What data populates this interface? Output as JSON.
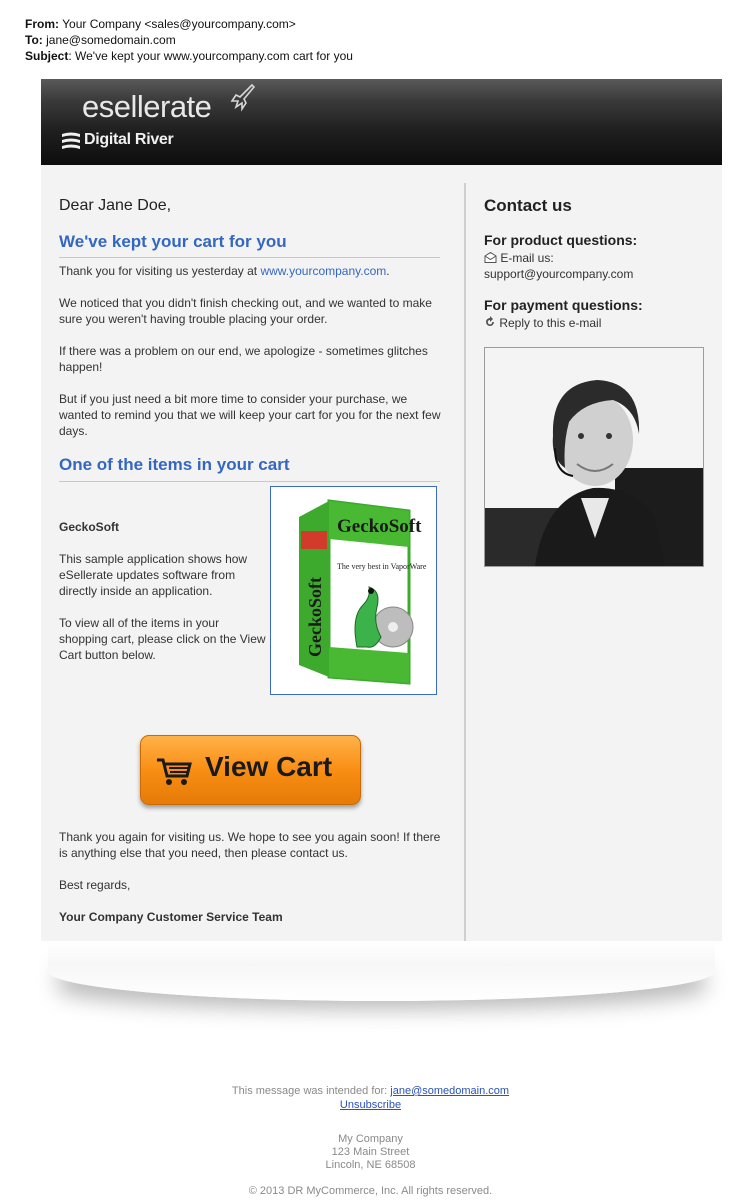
{
  "headers": {
    "from_label": "From:",
    "from_value": "Your Company <sales@yourcompany.com>",
    "to_label": "To:",
    "to_value": "jane@somedomain.com",
    "subject_label": "Subject",
    "subject_value": ": We've kept your www.yourcompany.com cart for you"
  },
  "banner": {
    "logo": "esellerate",
    "brand": "Digital River"
  },
  "main": {
    "greeting": "Dear Jane Doe,",
    "heading1": "We've kept your cart for you",
    "p1_prefix": "Thank you for visiting us yesterday at ",
    "p1_link": "www.yourcompany.com",
    "p1_suffix": ".",
    "p2": "We noticed that you didn't finish checking out, and we wanted to make sure you weren't having trouble placing your order.",
    "p3": "If there was a problem on our end, we apologize - sometimes glitches happen!",
    "p4": "But if you just need a bit more time to consider your purchase, we wanted to remind you that we will keep your cart for you for the next few days.",
    "heading2": "One of the items in your cart",
    "product_name": "GeckoSoft",
    "product_desc": "This sample application shows how eSellerate updates software from directly inside an application.",
    "product_hint": "To view all of the items in your shopping cart, please click on the View Cart button below.",
    "box_title": "GeckoSoft",
    "box_tagline": "The very best in VaporWare",
    "cta_label": "View Cart",
    "closing": "Thank you again for visiting us. We hope to see you again soon! If there is anything else that you need, then please contact us.",
    "regards": "Best regards,",
    "signature": "Your Company Customer Service Team"
  },
  "sidebar": {
    "title": "Contact us",
    "product_q": "For product questions:",
    "email_label": "E-mail us:",
    "email_link": "support@yourcompany.com",
    "payment_q": "For payment questions:",
    "reply_label": "Reply to this e-mail"
  },
  "footer": {
    "intended_prefix": "This message was intended for: ",
    "intended_email": "jane@somedomain.com",
    "unsubscribe": "Unsubscribe",
    "company": "My Company",
    "street": "123 Main Street",
    "city": "Lincoln, NE 68508",
    "copyright": "© 2013 DR MyCommerce, Inc. All rights reserved."
  },
  "colors": {
    "accent": "#3467c1",
    "cta": "#f98e14",
    "panel": "#f3f3f3"
  }
}
